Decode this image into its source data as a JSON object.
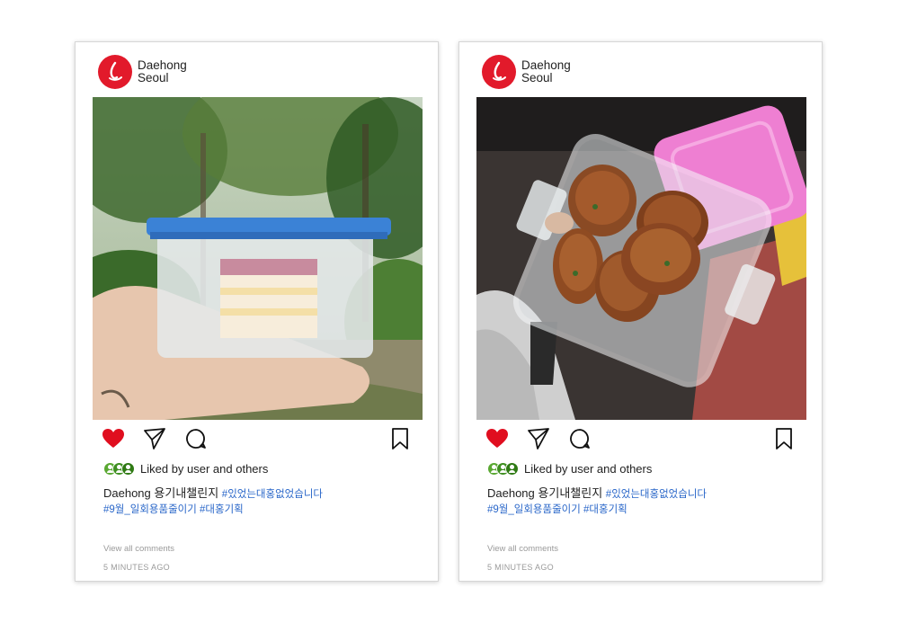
{
  "posts": [
    {
      "brand": {
        "line1": "Daehong",
        "line2": "Seoul"
      },
      "liked_text": "Liked by user and others",
      "caption": {
        "user": "Daehong",
        "text": "용기내챌린지",
        "tag1": "#있었는대홍없었습니다"
      },
      "caption_line2": {
        "tag2": "#9월_일회용품줄이기",
        "tag3": "#대홍기획"
      },
      "view_comments": "View all comments",
      "timestamp": "5 MINUTES AGO",
      "icons": [
        "heart-icon",
        "send-icon",
        "comment-icon",
        "bookmark-icon"
      ]
    },
    {
      "brand": {
        "line1": "Daehong",
        "line2": "Seoul"
      },
      "liked_text": "Liked by user and others",
      "caption": {
        "user": "Daehong",
        "text": "용기내챌린지",
        "tag1": "#있었는대홍없었습니다"
      },
      "caption_line2": {
        "tag2": "#9월_일회용품줄이기",
        "tag3": "#대홍기획"
      },
      "view_comments": "View all comments",
      "timestamp": "5 MINUTES AGO",
      "icons": [
        "heart-icon",
        "send-icon",
        "comment-icon",
        "bookmark-icon"
      ]
    }
  ],
  "colors": {
    "brand_red": "#e21a2b",
    "heart_red": "#e00e1f",
    "hashtag_blue": "#2a67c9",
    "avatar_green": "#4a9a2a"
  }
}
